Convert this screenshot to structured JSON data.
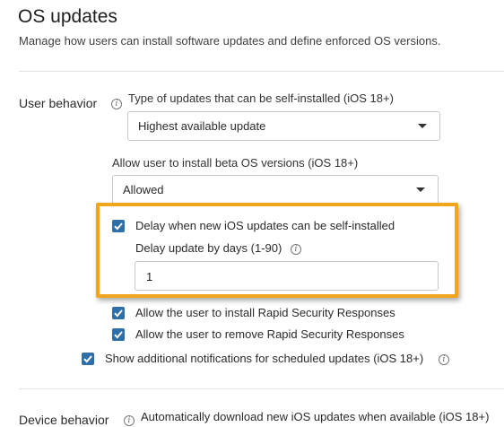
{
  "header": {
    "title": "OS updates",
    "description": "Manage how users can install software updates and define enforced OS versions."
  },
  "user_behavior": {
    "label": "User behavior",
    "update_type_label": "Type of updates that can be self-installed (iOS 18+)",
    "update_type_value": "Highest available update",
    "beta_label": "Allow user to install beta OS versions (iOS 18+)",
    "beta_value": "Allowed",
    "delay_checkbox_label": "Delay when new iOS updates can be self-installed",
    "delay_days_label": "Delay update by days (1-90)",
    "delay_days_value": "1",
    "rsr_install_label": "Allow the user to install Rapid Security Responses",
    "rsr_remove_label": "Allow the user to remove Rapid Security Responses",
    "notifications_label": "Show additional notifications for scheduled updates (iOS 18+)"
  },
  "device_behavior": {
    "label": "Device behavior",
    "auto_download_label": "Automatically download new iOS updates when available (iOS 18+)"
  },
  "colors": {
    "checkbox": "#2f6fa8",
    "highlight": "#f0a51c"
  }
}
